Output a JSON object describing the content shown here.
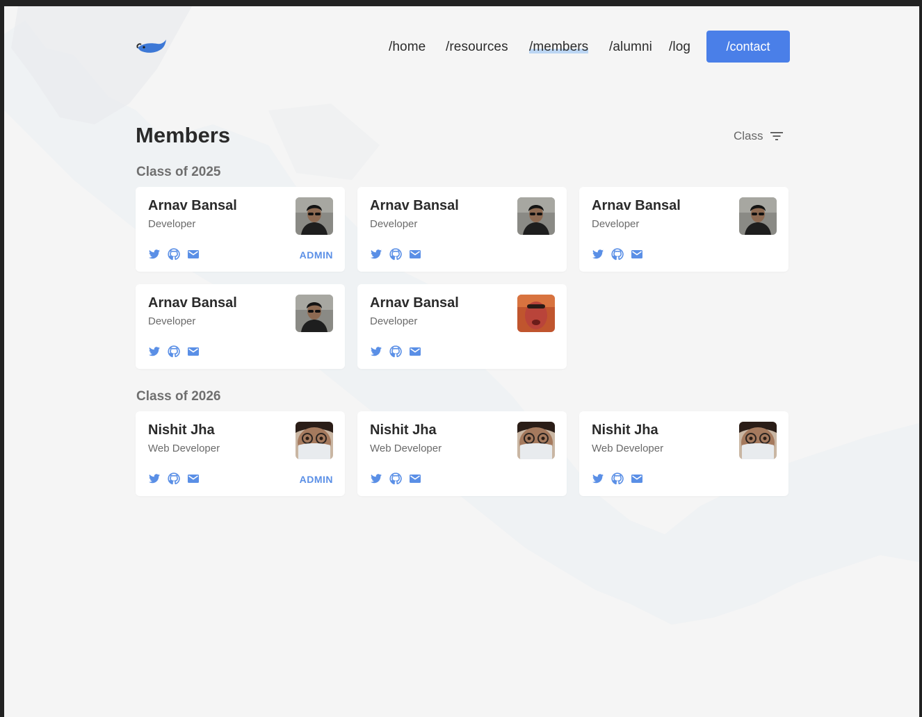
{
  "nav": {
    "logo_name": "logo-fish",
    "links": [
      "/home",
      "/resources",
      "/members",
      "/alumni",
      "/log"
    ],
    "active": "/members",
    "contact_label": "/contact"
  },
  "page": {
    "title": "Members",
    "filter_label": "Class",
    "filter_icon": "filter-icon"
  },
  "colors": {
    "accent": "#4a7fe8",
    "icon_blue": "#5a8fe6",
    "badge_blue": "#5a8fe6"
  },
  "sections": [
    {
      "heading": "Class of 2025",
      "members": [
        {
          "name": "Arnav Bansal",
          "role": "Developer",
          "badge": "ADMIN",
          "avatar": "avatar-arnav"
        },
        {
          "name": "Arnav Bansal",
          "role": "Developer",
          "badge": "",
          "avatar": "avatar-arnav"
        },
        {
          "name": "Arnav Bansal",
          "role": "Developer",
          "badge": "",
          "avatar": "avatar-arnav"
        },
        {
          "name": "Arnav Bansal",
          "role": "Developer",
          "badge": "",
          "avatar": "avatar-arnav"
        },
        {
          "name": "Arnav Bansal",
          "role": "Developer",
          "badge": "",
          "avatar": "avatar-alt"
        }
      ]
    },
    {
      "heading": "Class of 2026",
      "members": [
        {
          "name": "Nishit Jha",
          "role": "Web Developer",
          "badge": "ADMIN",
          "avatar": "avatar-nishit"
        },
        {
          "name": "Nishit Jha",
          "role": "Web Developer",
          "badge": "",
          "avatar": "avatar-nishit"
        },
        {
          "name": "Nishit Jha",
          "role": "Web Developer",
          "badge": "",
          "avatar": "avatar-nishit"
        }
      ]
    }
  ],
  "social_icons": [
    "twitter-icon",
    "github-icon",
    "mail-icon"
  ]
}
